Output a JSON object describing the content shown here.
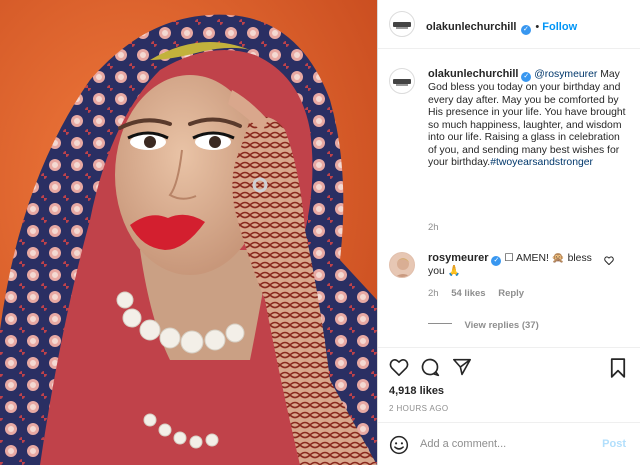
{
  "post": {
    "username": "olakunlechurchill",
    "follow_label": "Follow",
    "caption_mention": "@rosymeurer",
    "caption_body": "May God bless you today on your birthday and every day after. May you be comforted by His presence in your life. You have brought so much happiness, laughter, and wisdom into our life. Raising a glass in celebration of you, and sending many best wishes for your birthday.",
    "caption_hashtag": "#twoyearsandstronger",
    "caption_time": "2h"
  },
  "comment": {
    "username": "rosymeurer",
    "text_1": "☐ AMEN! 🙊 bless",
    "text_2": "you 🙏",
    "time": "2h",
    "likes": "54 likes",
    "reply_label": "Reply",
    "view_replies": "View replies (37)"
  },
  "actions": {
    "likes_count": "4,918 likes",
    "time_ago": "2 HOURS AGO",
    "add_comment_placeholder": "Add a comment...",
    "post_label": "Post"
  },
  "colors": {
    "accent": "#0095f6",
    "verified": "#3897f0",
    "photo_background": "#e0632b",
    "post_disabled": "#b2dffc"
  }
}
